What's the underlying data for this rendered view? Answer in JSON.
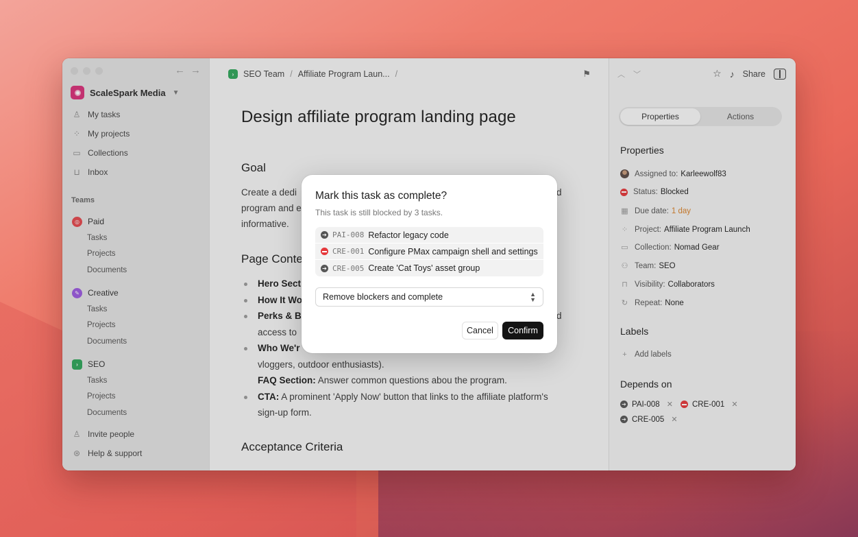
{
  "sidebar": {
    "workspace": "ScaleSpark Media",
    "items": [
      {
        "label": "My tasks",
        "icon": "person-icon"
      },
      {
        "label": "My projects",
        "icon": "grid-icon"
      },
      {
        "label": "Collections",
        "icon": "folder-icon"
      },
      {
        "label": "Inbox",
        "icon": "inbox-icon"
      }
    ],
    "teams_label": "Teams",
    "teams": [
      {
        "name": "Paid",
        "color": "#e5484d",
        "subs": [
          "Tasks",
          "Projects",
          "Documents"
        ]
      },
      {
        "name": "Creative",
        "color": "#9b59e0",
        "subs": [
          "Tasks",
          "Projects",
          "Documents"
        ]
      },
      {
        "name": "SEO",
        "color": "#2fa65a",
        "subs": [
          "Tasks",
          "Projects",
          "Documents"
        ]
      }
    ],
    "invite": "Invite people",
    "help": "Help & support"
  },
  "breadcrumb": {
    "team": "SEO Team",
    "sep1": "/",
    "project": "Affiliate Program Laun...",
    "sep2": "/"
  },
  "doc": {
    "title": "Design affiliate program landing page",
    "goal_heading": "Goal",
    "goal_line1": "Create a dedi",
    "goal_line1_end": "d",
    "goal_line2": "program and e",
    "goal_line3": "informative.",
    "content_heading": "Page Conte",
    "bullets": [
      {
        "bold": "Hero Sect",
        "text": ""
      },
      {
        "bold": "How It Wo",
        "text": ""
      },
      {
        "bold": "Perks & B",
        "text": "",
        "tail": "d"
      },
      {
        "bold": "",
        "text": "access to"
      },
      {
        "bold": "Who We'r",
        "text": ""
      },
      {
        "bold": "",
        "text": "vloggers, outdoor enthusiasts)."
      },
      {
        "bold": "FAQ Section:",
        "text": " Answer common questions abou the program."
      },
      {
        "bold": "CTA:",
        "text": " A prominent 'Apply Now' button that links to the affiliate platform's"
      },
      {
        "bold": "",
        "text": "sign-up form."
      }
    ],
    "acceptance_heading": "Acceptance Criteria"
  },
  "right_panel": {
    "share": "Share",
    "tabs": [
      "Properties",
      "Actions"
    ],
    "properties_title": "Properties",
    "properties": [
      {
        "label": "Assigned to:",
        "value": "Karleewolf83"
      },
      {
        "label": "Status:",
        "value": "Blocked"
      },
      {
        "label": "Due date:",
        "value": "1 day"
      },
      {
        "label": "Project:",
        "value": "Affiliate Program Launch"
      },
      {
        "label": "Collection:",
        "value": "Nomad Gear"
      },
      {
        "label": "Team:",
        "value": "SEO"
      },
      {
        "label": "Visibility:",
        "value": "Collaborators"
      },
      {
        "label": "Repeat:",
        "value": "None"
      }
    ],
    "labels_title": "Labels",
    "add_labels": "Add labels",
    "depends_title": "Depends on",
    "depends": [
      "PAI-008",
      "CRE-001",
      "CRE-005"
    ],
    "status_color": "#e5383b",
    "due_color": "#d9822b"
  },
  "modal": {
    "title": "Mark this task as complete?",
    "subtitle": "This task is still blocked by 3 tasks.",
    "blockers": [
      {
        "code": "PAI-008",
        "title": "Refactor legacy code",
        "status": "in-progress"
      },
      {
        "code": "CRE-001",
        "title": "Configure PMax campaign shell and settings",
        "status": "blocked"
      },
      {
        "code": "CRE-005",
        "title": "Create 'Cat Toys' asset group",
        "status": "in-progress"
      }
    ],
    "select_value": "Remove blockers and complete",
    "cancel": "Cancel",
    "confirm": "Confirm"
  }
}
